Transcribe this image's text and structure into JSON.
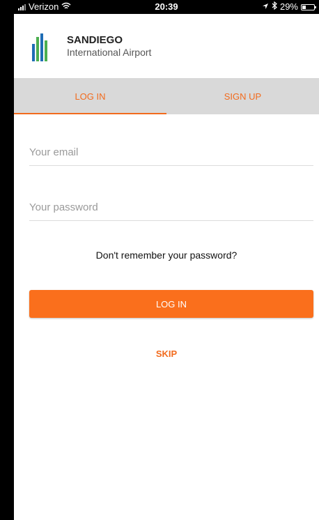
{
  "status_bar": {
    "carrier": "Verizon",
    "time": "20:39",
    "battery_percent": "29%",
    "battery_level": 0.29,
    "icons": [
      "signal-icon",
      "wifi-icon",
      "location-arrow-icon",
      "bluetooth-icon",
      "battery-icon"
    ]
  },
  "header": {
    "title": "SANDIEGO",
    "subtitle": "International Airport"
  },
  "tabs": [
    {
      "label": "LOG IN",
      "active": true
    },
    {
      "label": "SIGN UP",
      "active": false
    }
  ],
  "form": {
    "email": {
      "placeholder": "Your email",
      "value": ""
    },
    "password": {
      "placeholder": "Your password",
      "value": ""
    },
    "forgot_label": "Don't remember your password?",
    "login_label": "LOG IN",
    "skip_label": "SKIP"
  },
  "colors": {
    "accent": "#f26b1d",
    "button": "#fa6f1c",
    "tab_bar": "#d9d9d9",
    "logo_blue": "#1f6db5",
    "logo_green": "#4caf50"
  }
}
